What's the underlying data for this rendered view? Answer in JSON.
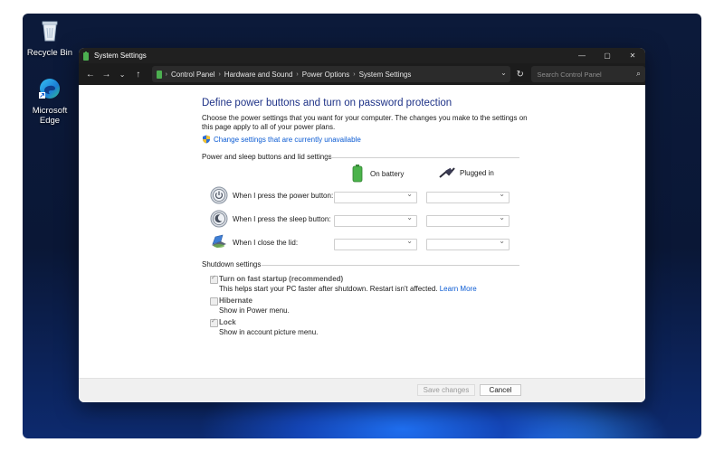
{
  "desktop": {
    "icons": [
      {
        "label": "Recycle Bin"
      },
      {
        "label": "Microsoft Edge"
      }
    ]
  },
  "window": {
    "title": "System Settings",
    "controls": {
      "minimize": "—",
      "maximize": "▢",
      "close": "✕"
    }
  },
  "address": {
    "breadcrumb": [
      "Control Panel",
      "Hardware and Sound",
      "Power Options",
      "System Settings"
    ],
    "search_placeholder": "Search Control Panel"
  },
  "main": {
    "heading": "Define power buttons and turn on password protection",
    "description": "Choose the power settings that you want for your computer. The changes you make to the settings on this page apply to all of your power plans.",
    "change_link": "Change settings that are currently unavailable",
    "power_section": {
      "title": "Power and sleep buttons and lid settings",
      "col_battery": "On battery",
      "col_plugged": "Plugged in",
      "rows": [
        {
          "label": "When I press the power button:",
          "battery": "",
          "plugged": ""
        },
        {
          "label": "When I press the sleep button:",
          "battery": "",
          "plugged": ""
        },
        {
          "label": "When I close the lid:",
          "battery": "",
          "plugged": ""
        }
      ]
    },
    "shutdown_section": {
      "title": "Shutdown settings",
      "options": [
        {
          "title": "Turn on fast startup (recommended)",
          "desc": "This helps start your PC faster after shutdown. Restart isn't affected.",
          "link": "Learn More",
          "checked": true
        },
        {
          "title": "Hibernate",
          "desc": "Show in Power menu.",
          "checked": false
        },
        {
          "title": "Lock",
          "desc": "Show in account picture menu.",
          "checked": true
        }
      ]
    }
  },
  "footer": {
    "save_label": "Save changes",
    "cancel_label": "Cancel"
  }
}
